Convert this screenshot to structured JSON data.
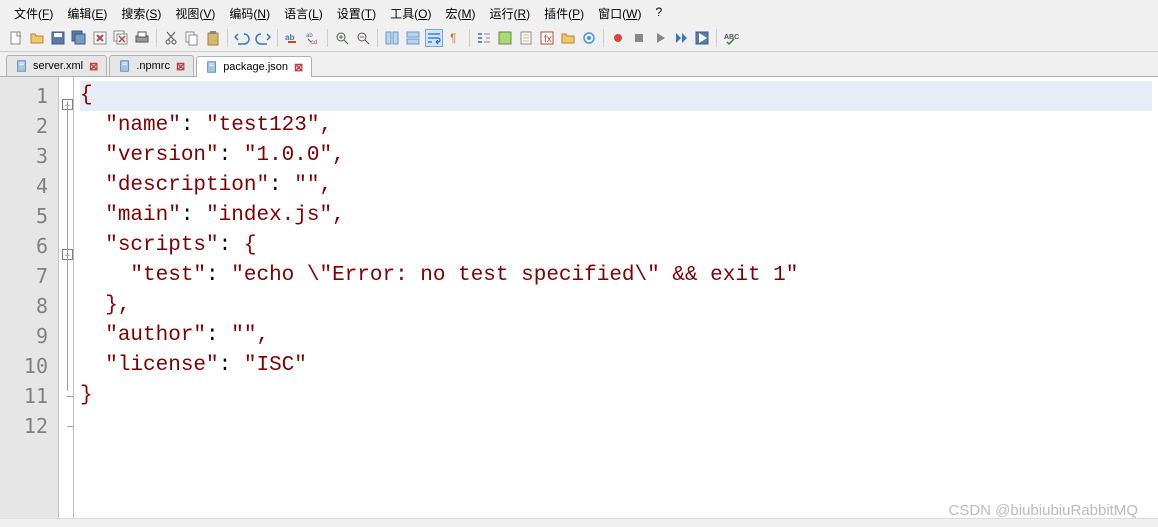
{
  "menu": {
    "items": [
      {
        "label": "文件",
        "u": "F"
      },
      {
        "label": "编辑",
        "u": "E"
      },
      {
        "label": "搜索",
        "u": "S"
      },
      {
        "label": "视图",
        "u": "V"
      },
      {
        "label": "编码",
        "u": "N"
      },
      {
        "label": "语言",
        "u": "L"
      },
      {
        "label": "设置",
        "u": "T"
      },
      {
        "label": "工具",
        "u": "O"
      },
      {
        "label": "宏",
        "u": "M"
      },
      {
        "label": "运行",
        "u": "R"
      },
      {
        "label": "插件",
        "u": "P"
      },
      {
        "label": "窗口",
        "u": "W"
      },
      {
        "label": "?",
        "u": ""
      }
    ]
  },
  "tabs": [
    {
      "label": "server.xml",
      "active": false
    },
    {
      "label": ".npmrc",
      "active": false
    },
    {
      "label": "package.json",
      "active": true
    }
  ],
  "code": {
    "lines": [
      {
        "n": 1,
        "fold": "minus",
        "seg": [
          {
            "t": "brace",
            "v": "{"
          }
        ]
      },
      {
        "n": 2,
        "seg": [
          {
            "t": "ind",
            "v": "  "
          },
          {
            "t": "key",
            "v": "\"name\""
          },
          {
            "t": "op",
            "v": ": "
          },
          {
            "t": "str",
            "v": "\"test123\""
          },
          {
            "t": "punct",
            "v": ","
          }
        ]
      },
      {
        "n": 3,
        "seg": [
          {
            "t": "ind",
            "v": "  "
          },
          {
            "t": "key",
            "v": "\"version\""
          },
          {
            "t": "op",
            "v": ": "
          },
          {
            "t": "str",
            "v": "\"1.0.0\""
          },
          {
            "t": "punct",
            "v": ","
          }
        ]
      },
      {
        "n": 4,
        "seg": [
          {
            "t": "ind",
            "v": "  "
          },
          {
            "t": "key",
            "v": "\"description\""
          },
          {
            "t": "op",
            "v": ": "
          },
          {
            "t": "str",
            "v": "\"\""
          },
          {
            "t": "punct",
            "v": ","
          }
        ]
      },
      {
        "n": 5,
        "seg": [
          {
            "t": "ind",
            "v": "  "
          },
          {
            "t": "key",
            "v": "\"main\""
          },
          {
            "t": "op",
            "v": ": "
          },
          {
            "t": "str",
            "v": "\"index.js\""
          },
          {
            "t": "punct",
            "v": ","
          }
        ]
      },
      {
        "n": 6,
        "fold": "minus",
        "seg": [
          {
            "t": "ind",
            "v": "  "
          },
          {
            "t": "key",
            "v": "\"scripts\""
          },
          {
            "t": "op",
            "v": ": "
          },
          {
            "t": "brace",
            "v": "{"
          }
        ]
      },
      {
        "n": 7,
        "seg": [
          {
            "t": "ind",
            "v": "    "
          },
          {
            "t": "key",
            "v": "\"test\""
          },
          {
            "t": "op",
            "v": ": "
          },
          {
            "t": "str",
            "v": "\"echo \\\"Error: no test specified\\\" && exit 1\""
          }
        ]
      },
      {
        "n": 8,
        "seg": [
          {
            "t": "ind",
            "v": "  "
          },
          {
            "t": "brace",
            "v": "}"
          },
          {
            "t": "punct",
            "v": ","
          }
        ]
      },
      {
        "n": 9,
        "seg": [
          {
            "t": "ind",
            "v": "  "
          },
          {
            "t": "key",
            "v": "\"author\""
          },
          {
            "t": "op",
            "v": ": "
          },
          {
            "t": "str",
            "v": "\"\""
          },
          {
            "t": "punct",
            "v": ","
          }
        ]
      },
      {
        "n": 10,
        "seg": [
          {
            "t": "ind",
            "v": "  "
          },
          {
            "t": "key",
            "v": "\"license\""
          },
          {
            "t": "op",
            "v": ": "
          },
          {
            "t": "str",
            "v": "\"ISC\""
          }
        ]
      },
      {
        "n": 11,
        "seg": [
          {
            "t": "brace",
            "v": "}"
          }
        ]
      },
      {
        "n": 12,
        "seg": []
      }
    ]
  },
  "watermark": "CSDN @biubiubiuRabbitMQ"
}
